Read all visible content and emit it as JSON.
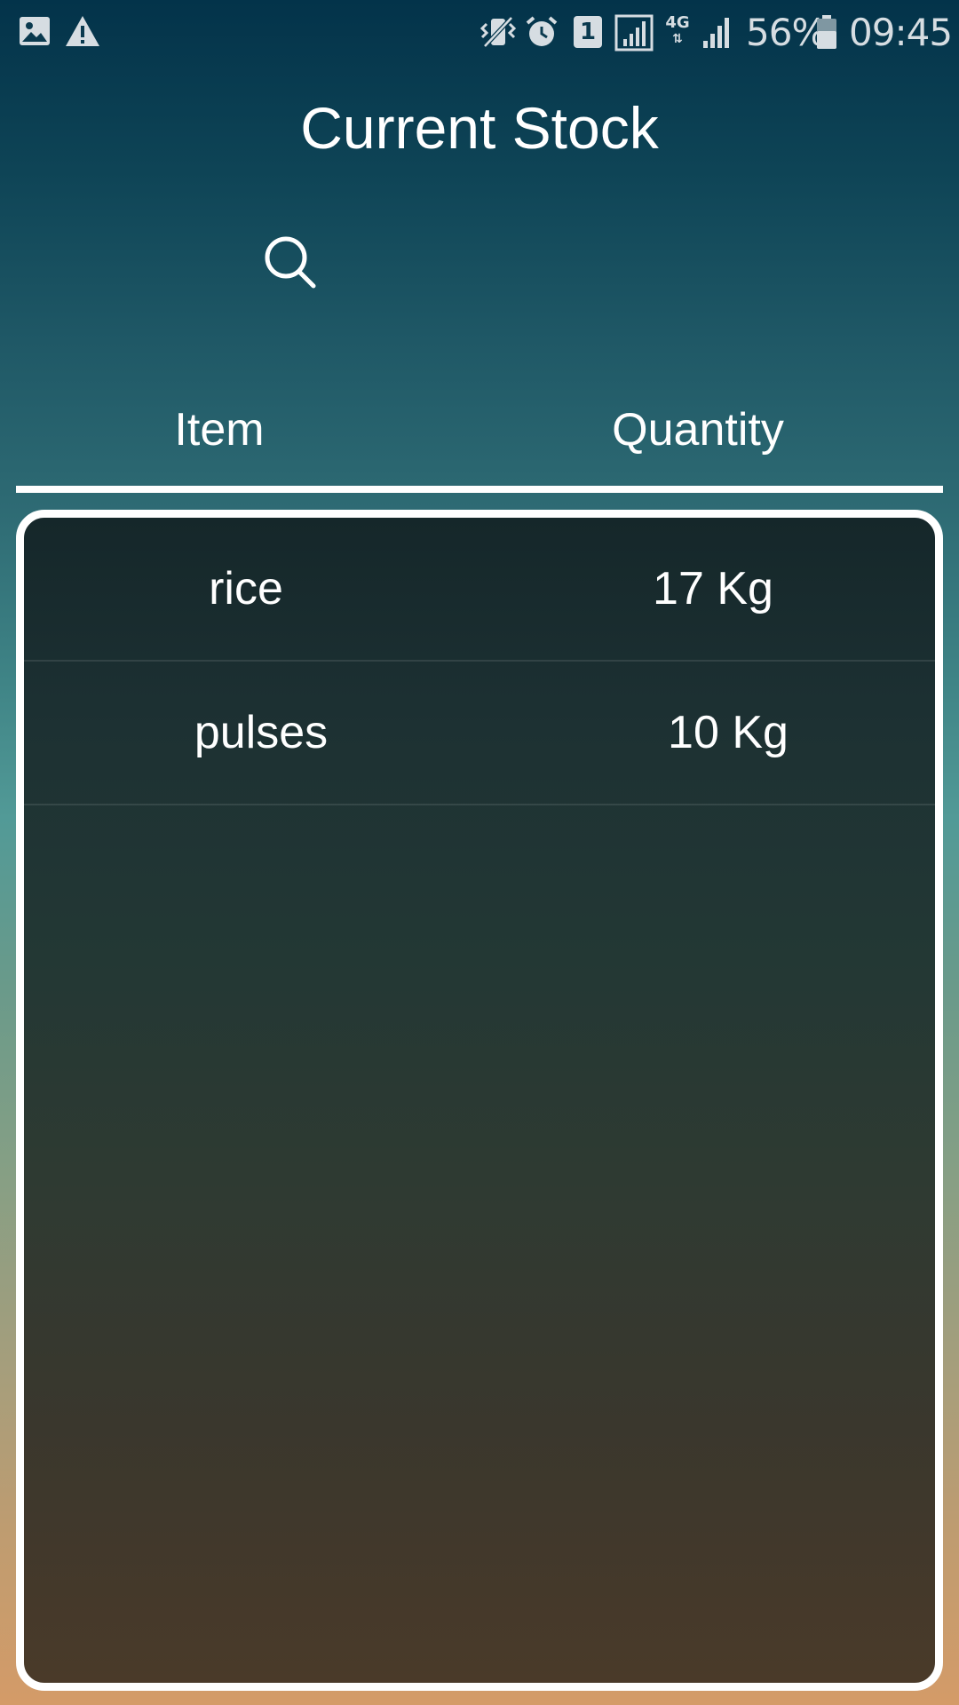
{
  "status_bar": {
    "icons": [
      "image-icon",
      "warning-icon",
      "vibrate-icon",
      "alarm-icon",
      "sim-1-icon",
      "signal-icon",
      "4g-icon",
      "signal-icon",
      "battery-icon"
    ],
    "network_label": "4G",
    "sim_label": "1",
    "battery_percent": "56%",
    "time": "09:45"
  },
  "header": {
    "title": "Current Stock",
    "search_icon": "search-icon"
  },
  "table": {
    "columns": [
      "Item",
      "Quantity"
    ],
    "rows": [
      {
        "item": "rice",
        "quantity": "17 Kg"
      },
      {
        "item": "pulses",
        "quantity": "10 Kg"
      }
    ]
  },
  "colors": {
    "background_top": "#03334a",
    "background_middle": "#529a97",
    "background_bottom": "#d49b68",
    "panel_top": "#15272a",
    "panel_bottom": "#4a3a29",
    "text": "#ffffff",
    "status_text": "#d6dde2"
  }
}
